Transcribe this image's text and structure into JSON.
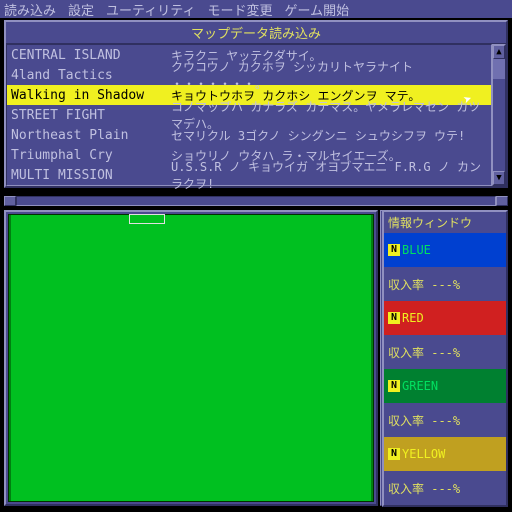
{
  "menu": {
    "items": [
      "読み込み",
      "設定",
      "ユーティリティ",
      "モード変更",
      "ゲーム開始"
    ]
  },
  "map_load": {
    "title": "マップデータ読み込み",
    "rows": [
      {
        "name": "CENTRAL ISLAND",
        "desc": "キラクニ ヤッテクダサイ。"
      },
      {
        "name": "4land Tactics",
        "desc": "クウコウノ カクホヲ シッカリトヤラナイト ・・・・・・・。"
      },
      {
        "name": "Walking in Shadow",
        "desc": "キョウトウホヲ カクホシ エングンヲ マテ。"
      },
      {
        "name": "STREET FIGHT",
        "desc": "コノマップハ カナラズ カテマス。ヤメラレマセン カツマデハ。"
      },
      {
        "name": "Northeast Plain",
        "desc": "セマリクル 3ゴクノ シングンニ シュウシフヲ ウテ!"
      },
      {
        "name": "Triumphal Cry",
        "desc": "ショウリノ ウタハ ラ・マルセイエーズ。"
      },
      {
        "name": "MULTI MISSION",
        "desc": "U.S.S.R ノ キョウイガ オヨブマエニ F.R.G ノ カンラクヲ!"
      }
    ],
    "selected_index": 2
  },
  "info": {
    "title": "情報ウィンドウ",
    "rate_label": "収入率",
    "rate_value": "---%",
    "n_badge": "N",
    "factions": [
      {
        "label": "BLUE",
        "bg": "#0040d0",
        "fg": "#00e060"
      },
      {
        "label": "RED",
        "bg": "#d02020",
        "fg": "#f0f020"
      },
      {
        "label": "GREEN",
        "bg": "#008030",
        "fg": "#00e060"
      },
      {
        "label": "YELLOW",
        "bg": "#c0a020",
        "fg": "#f0f020"
      }
    ]
  }
}
